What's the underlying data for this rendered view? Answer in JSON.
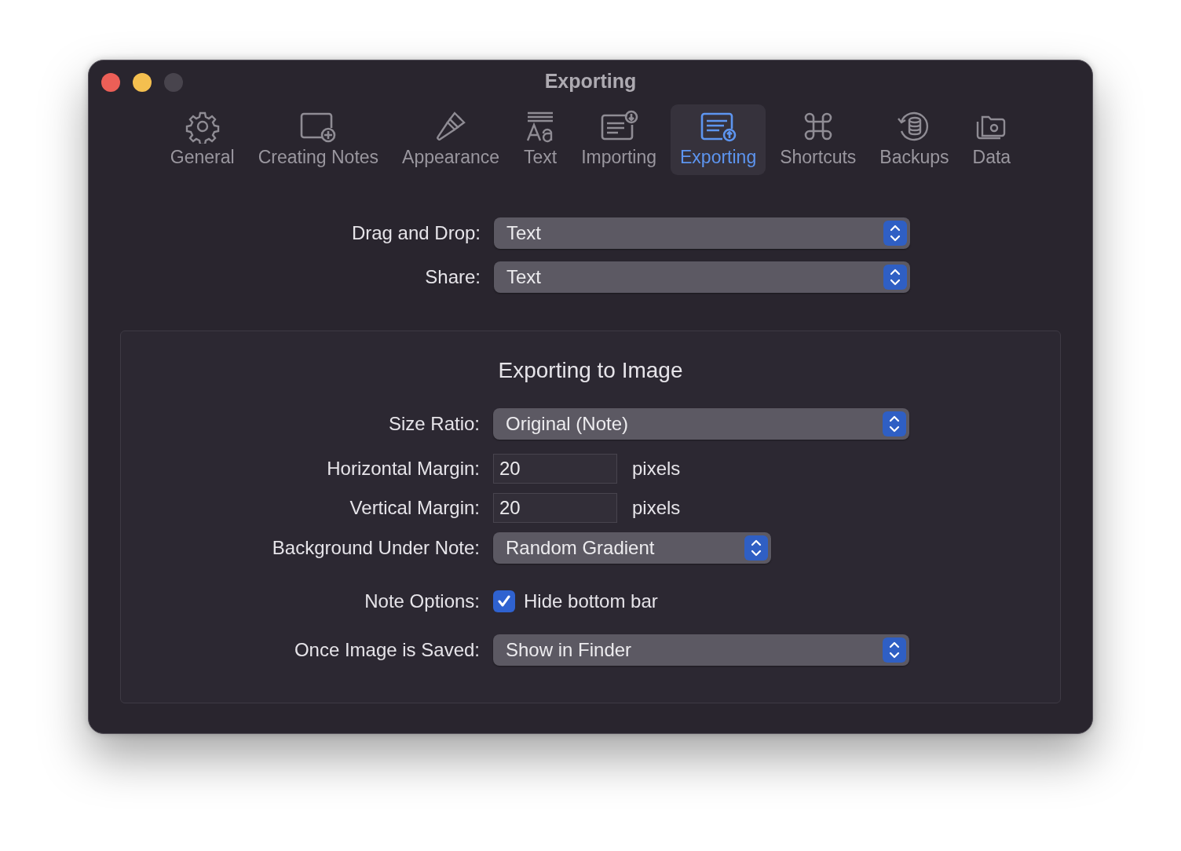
{
  "window": {
    "title": "Exporting"
  },
  "tabs": [
    {
      "label": "General",
      "selected": false
    },
    {
      "label": "Creating Notes",
      "selected": false
    },
    {
      "label": "Appearance",
      "selected": false
    },
    {
      "label": "Text",
      "selected": false
    },
    {
      "label": "Importing",
      "selected": false
    },
    {
      "label": "Exporting",
      "selected": true
    },
    {
      "label": "Shortcuts",
      "selected": false
    },
    {
      "label": "Backups",
      "selected": false
    },
    {
      "label": "Data",
      "selected": false
    }
  ],
  "settings": [
    {
      "label": "Drag and Drop:",
      "kind": "popup",
      "value": "Text"
    },
    {
      "label": "Share:",
      "kind": "popup",
      "value": "Text"
    }
  ],
  "image_group": {
    "title": "Exporting to Image",
    "rows": [
      {
        "label": "Size Ratio:",
        "kind": "popup",
        "value": "Original (Note)"
      },
      {
        "label": "Horizontal Margin:",
        "kind": "field",
        "value": "20",
        "unit": "pixels"
      },
      {
        "label": "Vertical Margin:",
        "kind": "field",
        "value": "20",
        "unit": "pixels"
      },
      {
        "label": "Background Under Note:",
        "kind": "popup-short",
        "value": "Random Gradient"
      },
      {
        "label": "Note Options:",
        "kind": "checkbox",
        "text": "Hide bottom bar",
        "checked": true
      },
      {
        "label": "Once Image is Saved:",
        "kind": "popup",
        "value": "Show in Finder"
      }
    ]
  }
}
